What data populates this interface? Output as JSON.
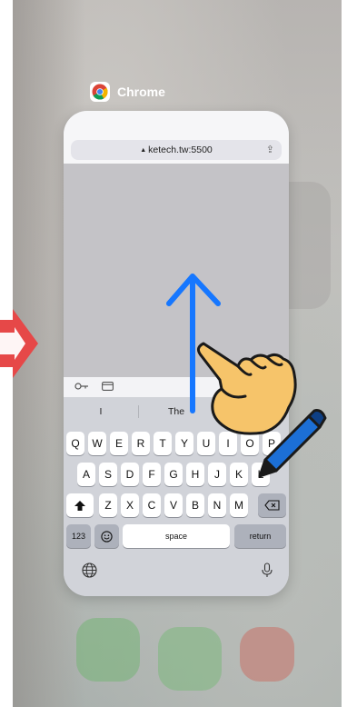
{
  "app_switcher": {
    "app_name": "Chrome"
  },
  "browser": {
    "url": "ketech.tw:5500"
  },
  "keyboard": {
    "suggestions": [
      "I",
      "The",
      ""
    ],
    "row1": [
      "Q",
      "W",
      "E",
      "R",
      "T",
      "Y",
      "U",
      "I",
      "O",
      "P"
    ],
    "row2": [
      "A",
      "S",
      "D",
      "F",
      "G",
      "H",
      "J",
      "K",
      "L"
    ],
    "row3": [
      "Z",
      "X",
      "C",
      "V",
      "B",
      "N",
      "M"
    ],
    "numbers_key": "123",
    "space_key": "space",
    "return_key": "return"
  },
  "icons": {
    "shift": "shift-arrow-icon",
    "backspace": "backspace-icon",
    "emoji": "emoji-icon",
    "globe": "globe-icon",
    "mic": "microphone-icon",
    "key": "key-icon",
    "card": "credit-card-icon",
    "share": "share-icon"
  },
  "colors": {
    "swipe_arrow": "#1677ff",
    "red_arrow": "#e64848",
    "pen": "#1c6fd6",
    "hand": "#f6c46a"
  }
}
